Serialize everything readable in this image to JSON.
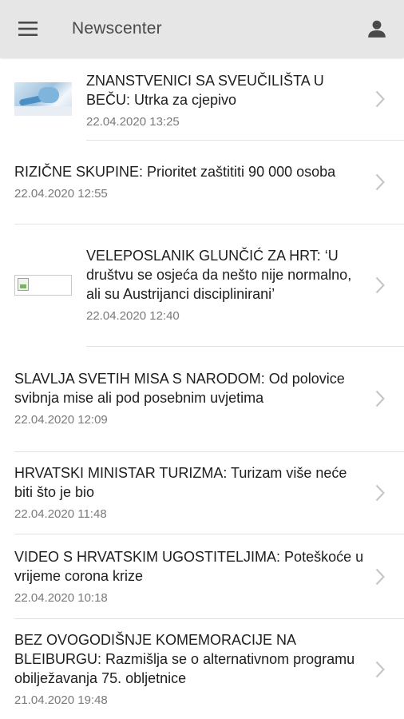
{
  "app_bar": {
    "title": "Newscenter",
    "menu_icon": "hamburger-menu-icon",
    "account_icon": "person-icon",
    "background": "#e6e6e6"
  },
  "news": [
    {
      "title": "ZNANSTVENICI SA SVEUČILIŠTA U BEČU: Utrka za cjepivo",
      "date": "22.04.2020 13:25",
      "thumbnail": "lab-photo"
    },
    {
      "title": "RIZIČNE SKUPINE: Prioritet zaštititi 90 000 osoba",
      "date": "22.04.2020 12:55"
    },
    {
      "title": "VELEPOSLANIK GLUNČIĆ ZA HRT: ‘U društvu se osjeća da nešto nije normalno, ali su Austrijanci disciplinirani’",
      "date": "22.04.2020 12:40",
      "thumbnail": "broken-image"
    },
    {
      "title": "SLAVLJA SVETIH MISA S NARODOM: Od polovice svibnja mise ali pod posebnim uvjetima",
      "date": "22.04.2020 12:09"
    },
    {
      "title": "HRVATSKI MINISTAR TURIZMA: Turizam više neće biti što je bio",
      "date": "22.04.2020 11:48"
    },
    {
      "title": "VIDEO S HRVATSKIM UGOSTITELJIMA: Poteškoće u vrijeme corona krize",
      "date": "22.04.2020 10:18"
    },
    {
      "title": "BEZ OVOGODIŠNJE KOMEMORACIJE NA BLEIBURGU: Razmišlja se o alternativnom programu obilježavanja 75. obljetnice",
      "date": "21.04.2020 19:48"
    }
  ]
}
